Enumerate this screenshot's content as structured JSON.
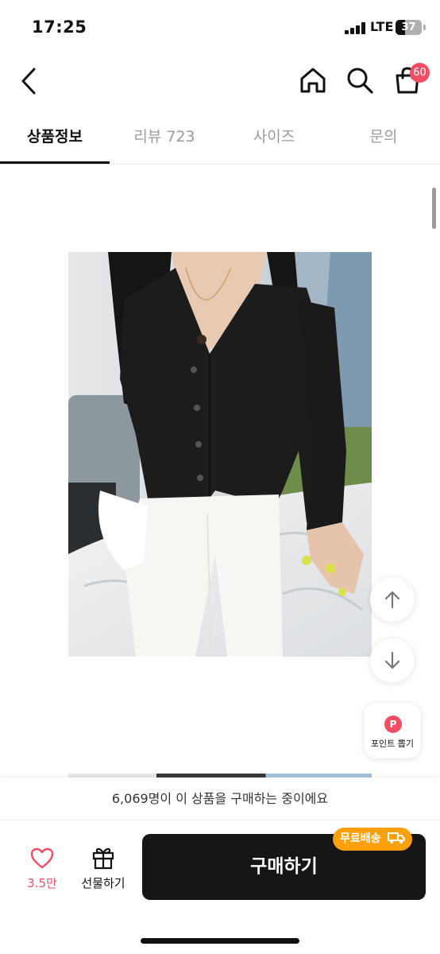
{
  "status_bar": {
    "time": "17:25",
    "network": "LTE",
    "battery": "37",
    "battery_level": 0.37
  },
  "nav": {
    "back_icon": "chevron-left-icon",
    "home_icon": "home-icon",
    "search_icon": "search-icon",
    "cart_icon": "shopping-bag-icon",
    "cart_badge": "60"
  },
  "tabs": [
    {
      "label": "상품정보",
      "active": true
    },
    {
      "label": "리뷰 723",
      "active": false
    },
    {
      "label": "사이즈",
      "active": false
    },
    {
      "label": "문의",
      "active": false
    }
  ],
  "floating": {
    "scroll_up_icon": "arrow-up-icon",
    "scroll_down_icon": "arrow-down-icon",
    "point_icon_letter": "P",
    "point_label": "포인트 뽑기"
  },
  "purchase": {
    "count_text": "6,069명이 이 상품을 구매하는 중이에요",
    "like_count": "3.5만",
    "gift_label": "선물하기",
    "buy_label": "구매하기",
    "free_shipping": "무료배송"
  },
  "colors": {
    "accent": "#f24e63",
    "buy_button": "#161616",
    "free_shipping_badge": "#ff9f0a"
  }
}
